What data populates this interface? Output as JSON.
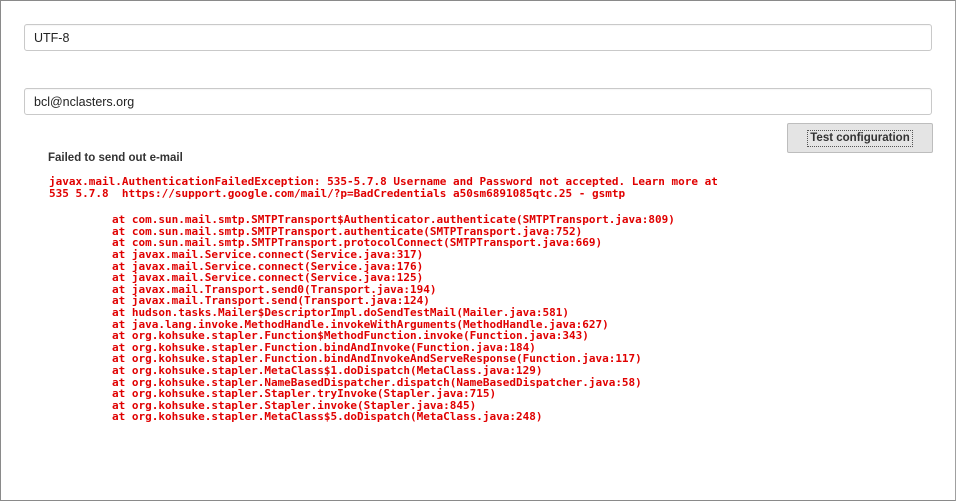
{
  "form": {
    "charset_value": "UTF-8",
    "test_recipient_value": "bcl@nclasters.org",
    "test_button_label": "Test configuration"
  },
  "error": {
    "heading": "Failed to send out e-mail",
    "message_lines": [
      "javax.mail.AuthenticationFailedException: 535-5.7.8 Username and Password not accepted. Learn more at",
      "535 5.7.8  https://support.google.com/mail/?p=BadCredentials a50sm6891085qtc.25 - gsmtp"
    ],
    "stack_frames": [
      "at com.sun.mail.smtp.SMTPTransport$Authenticator.authenticate(SMTPTransport.java:809)",
      "at com.sun.mail.smtp.SMTPTransport.authenticate(SMTPTransport.java:752)",
      "at com.sun.mail.smtp.SMTPTransport.protocolConnect(SMTPTransport.java:669)",
      "at javax.mail.Service.connect(Service.java:317)",
      "at javax.mail.Service.connect(Service.java:176)",
      "at javax.mail.Service.connect(Service.java:125)",
      "at javax.mail.Transport.send0(Transport.java:194)",
      "at javax.mail.Transport.send(Transport.java:124)",
      "at hudson.tasks.Mailer$DescriptorImpl.doSendTestMail(Mailer.java:581)",
      "at java.lang.invoke.MethodHandle.invokeWithArguments(MethodHandle.java:627)",
      "at org.kohsuke.stapler.Function$MethodFunction.invoke(Function.java:343)",
      "at org.kohsuke.stapler.Function.bindAndInvoke(Function.java:184)",
      "at org.kohsuke.stapler.Function.bindAndInvokeAndServeResponse(Function.java:117)",
      "at org.kohsuke.stapler.MetaClass$1.doDispatch(MetaClass.java:129)",
      "at org.kohsuke.stapler.NameBasedDispatcher.dispatch(NameBasedDispatcher.java:58)",
      "at org.kohsuke.stapler.Stapler.tryInvoke(Stapler.java:715)",
      "at org.kohsuke.stapler.Stapler.invoke(Stapler.java:845)",
      "at org.kohsuke.stapler.MetaClass$5.doDispatch(MetaClass.java:248)"
    ]
  },
  "colors": {
    "error_text": "#e00000",
    "button_bg": "#e4e4e4"
  }
}
